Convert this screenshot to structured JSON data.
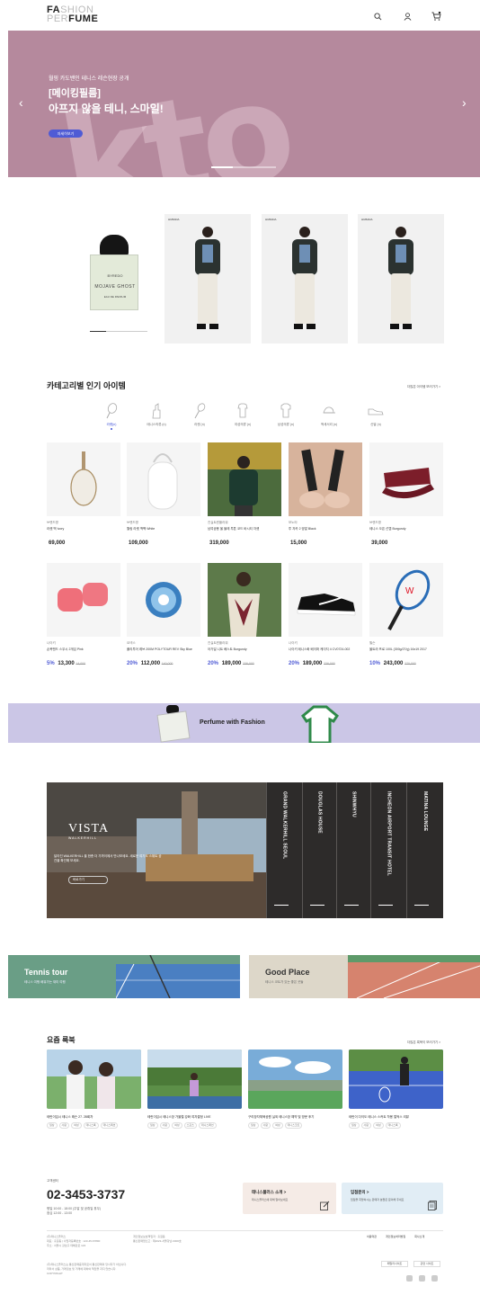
{
  "header": {
    "logo": {
      "line1_a": "FA",
      "line1_b": "SHION",
      "line2_a": "PER",
      "line2_b": "FUME"
    },
    "icons": [
      "search-icon",
      "user-icon",
      "cart-icon"
    ]
  },
  "hero": {
    "subtitle": "월핑 카도밴인 테니스 레슨현장 공개",
    "title_line1": "[메이킹필름]",
    "title_line2": "아프지 않을 테니, 스마일!",
    "button": "자세히보기",
    "watermark": "kto",
    "bg_color": "#b5899d",
    "slide_progress": 0.33
  },
  "featured": {
    "perfume_brand": "BYREDO",
    "perfume_name": "MOJAVE GHOST",
    "perfume_sub": "EAU DE PARFUM",
    "look_brands": [
      "HUBADA",
      "HUBADA",
      "HUBADA"
    ]
  },
  "categories": {
    "title": "카테고리별 인기 아이템",
    "more": "더많은 아이템 보러가기 >",
    "items": [
      {
        "label": "라켓(n)",
        "icon": "racket-icon"
      },
      {
        "label": "테니스의류 (n)",
        "icon": "apparel-icon"
      },
      {
        "label": "라켓 (n)",
        "icon": "racket-icon"
      },
      {
        "label": "여성의류 (n)",
        "icon": "shirt-icon"
      },
      {
        "label": "남성의류 (n)",
        "icon": "shirt-icon"
      },
      {
        "label": "액세서리 (n)",
        "icon": "cap-icon"
      },
      {
        "label": "신발 (n)",
        "icon": "shoe-icon"
      }
    ]
  },
  "products": [
    {
      "brand": "브랜드명",
      "name": "라켓 백 Ivory",
      "price": "69,000",
      "discount": "",
      "original": ""
    },
    {
      "brand": "브랜드명",
      "name": "월링 라켓 백팩 White",
      "price": "109,000",
      "discount": "",
      "original": ""
    },
    {
      "brand": "진실트윈플라워",
      "name": "남여공용 울 블레 투톤 코드 바시티 자켓",
      "price": "319,000",
      "discount": "",
      "original": ""
    },
    {
      "brand": "모노타",
      "name": "투 자카 2 양말 Black",
      "price": "15,000",
      "discount": "",
      "original": ""
    },
    {
      "brand": "브랜드명",
      "name": "테니스 오픈 선캡 Burgundy",
      "price": "39,000",
      "discount": "",
      "original": ""
    },
    {
      "brand": "나이키",
      "name": "손목밴드 스우시 2개입 Pink",
      "price": "13,300",
      "discount": "5%",
      "original": "14,000"
    },
    {
      "brand": "요넥스",
      "name": "폴리투어 레브 200M POLYTOUR REV Sky Blue",
      "price": "112,000",
      "discount": "20%",
      "original": "140,000"
    },
    {
      "brand": "진실트윈플라워",
      "name": "아가일 니트 베스트 Burgundy",
      "price": "189,000",
      "discount": "20%",
      "original": "236,000"
    },
    {
      "brand": "나이키",
      "name": "나이키 테니스화 베이퍼 케이지 4 CV0724-002",
      "price": "189,000",
      "discount": "20%",
      "original": "236,000"
    },
    {
      "brand": "윌슨",
      "name": "울트라 프로 100L (300g/27/g) 16x19 2017",
      "price": "243,000",
      "discount": "10%",
      "original": "270,000"
    }
  ],
  "promo": {
    "title": "Perfume with Fashion",
    "bg_color": "#cbc6e6"
  },
  "hotel": {
    "logo": "VISTA",
    "logo_sub": "WALKERHILL",
    "desc": "달라진 WALKERHILL 을 한층 더 가까이에서 만나보세요. 새로운 여기도 스위트 공간을 확인해 보세요.",
    "button": "바로가기",
    "strips": [
      "GRAND WALKERHILL SEOUL",
      "DOUGLAS HOUSE",
      "SHINWHYU",
      "INCHEON AIRPORT TRANSIT HOTEL",
      "MATINA LOUNGE"
    ]
  },
  "banners": [
    {
      "title": "Tennis tour",
      "subtitle": "테니스 여행 배워가는 재미 여행",
      "bg_color": "#6a9e86"
    },
    {
      "title": "Good Place",
      "subtitle": "테니스 코트가 있는 좋은 곳들",
      "bg_color": "#ddd7c9"
    }
  ],
  "magazine": {
    "title": "요즘 룩북",
    "more": "더많은 룩북이 보러가기 >",
    "items": [
      {
        "title": "테린이입시 테니스 레슨 27. 28회차",
        "tags": [
          "일상",
          "사람",
          "여성",
          "테니스룩",
          "테니스패션"
        ]
      },
      {
        "title": "테린이입시 테니스장 가을철 강화 여자결정 LIVE",
        "tags": [
          "일상",
          "사람",
          "여성",
          "스포츠",
          "테니스패션"
        ]
      },
      {
        "title": "구리장자체육공원 실외 테니스장 예약 및 방문 후기",
        "tags": [
          "일상",
          "사람",
          "여성",
          "테니스코트"
        ]
      },
      {
        "title": "테린이 다이도 테니스 스커트 착용 얼씩스 리뷰",
        "tags": [
          "일상",
          "사람",
          "여성",
          "테니스룩"
        ]
      }
    ]
  },
  "cs": {
    "label": "고객센터",
    "phone": "02-3453-3737",
    "hours1": "평일 10:00 - 18:00 (주말 및 공휴일 휴무)",
    "hours2": "점심 12:00 - 13:00"
  },
  "cards": [
    {
      "title": "테니스플러스 소개 >",
      "subtitle": "테니스플러스에 대해 알아보세요",
      "icon": "edit-icon",
      "bg_color": "#f5ebe6"
    },
    {
      "title": "입점문의 >",
      "subtitle": "입점을 희망하시는 판매자 분들은 문의해 주세요",
      "icon": "document-icon",
      "bg_color": "#e1edf5"
    }
  ],
  "footer": {
    "company1": "(주)테니스플러스",
    "company2": "대표 : 홍길동 | 사업자등록번호 : 123-45-67890",
    "company3": "주소 : 서울시 강남구 테헤란로 123",
    "mid1": "개인정보보호책임자 : 홍길동",
    "mid2": "통신판매업신고 : 제2023-서울강남-0000호",
    "links": [
      "이용약관",
      "개인정보처리방침",
      "회사소개"
    ],
    "legal1": "(주)테니스플러스는 통신판매중개자로서 통신판매의 당사자가 아닙니다.",
    "legal2": "따라서 상품, 거래정보 및 거래에 대하여 책임을 지지 않습니다.",
    "copyright": "COPYRIGHT",
    "buttons": [
      "패밀리사이트",
      "관련 사이트"
    ],
    "social": [
      "instagram-icon",
      "kakao-icon",
      "youtube-icon"
    ]
  }
}
